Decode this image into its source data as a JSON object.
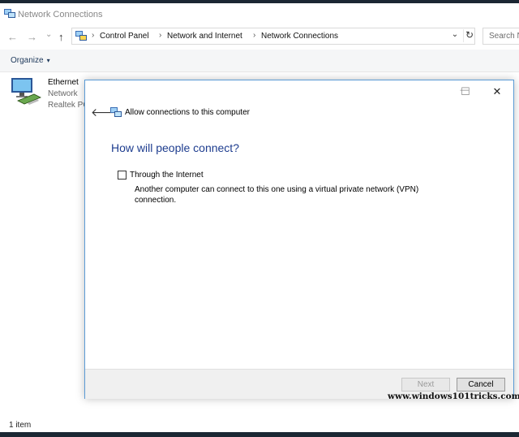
{
  "window": {
    "title": "Network Connections",
    "icon": "network-connections-icon"
  },
  "nav": {
    "back_icon": "←",
    "forward_icon": "→",
    "recent_icon": "⌄",
    "up_icon": "↑"
  },
  "address": {
    "crumbs": [
      "Control Panel",
      "Network and Internet",
      "Network Connections"
    ],
    "separator": "›",
    "dropdown_icon": "⌄",
    "refresh_icon": "↻"
  },
  "search": {
    "placeholder": "Search N"
  },
  "command_bar": {
    "organize_label": "Organize",
    "organize_caret": "▾"
  },
  "items": [
    {
      "name": "Ethernet",
      "status": "Network",
      "device": "Realtek PC"
    }
  ],
  "status_bar": {
    "item_count": "1 item"
  },
  "dialog": {
    "back_icon": "🡐",
    "title": "Allow connections to this computer",
    "minimize_icon": "—",
    "maximize_icon": "☐",
    "close_icon": "✕",
    "heading": "How will people connect?",
    "option": {
      "label": "Through the Internet",
      "checked": false,
      "description": "Another computer can connect to this one using a virtual private network (VPN) connection."
    },
    "buttons": {
      "next": "Next",
      "cancel": "Cancel"
    }
  },
  "watermark": "www.windows101tricks.com",
  "colors": {
    "accent_blue": "#1e3d8f",
    "dialog_border": "#5b9bd5",
    "taskbar": "#1b2733"
  }
}
